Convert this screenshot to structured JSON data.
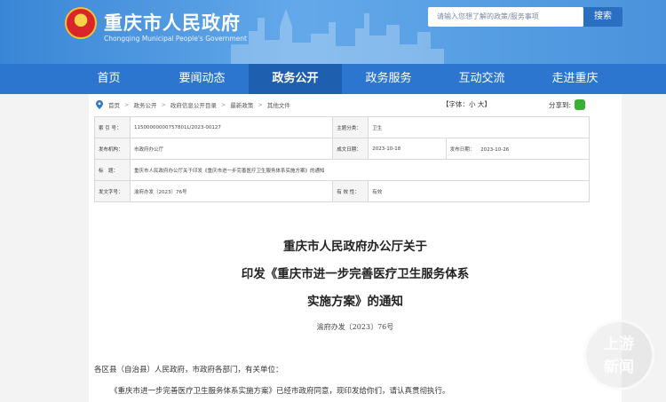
{
  "header": {
    "site_title": "重庆市人民政府",
    "site_subtitle": "Chongqing Municipal People's Government",
    "search_placeholder": "请输入您想了解的政策/服务事项",
    "search_button": "搜索"
  },
  "nav": {
    "items": [
      "首页",
      "要闻动态",
      "政务公开",
      "政务服务",
      "互动交流",
      "走进重庆"
    ],
    "active_index": 2
  },
  "breadcrumb": [
    "首页",
    "政务公开",
    "政府信息公开目录",
    "最新政策",
    "其他文件"
  ],
  "toolbar": {
    "font_size": "【字体：小 大】",
    "share": "分享到:"
  },
  "meta": {
    "index_no_label": "索 引 号：",
    "index_no": "11500000000757801L/2023-00127",
    "category_label": "主题分类：",
    "category": "卫生",
    "issuer_label": "发布机构：",
    "issuer": "市政府办公厅",
    "created_label": "成文日期：",
    "created": "2023-10-18",
    "published_label": "发布日期：",
    "published": "2023-10-26",
    "subject_label": "标　题：",
    "subject": "重庆市人民政府办公厅关于印发《重庆市进一步完善医疗卫生服务体系实施方案》的通知",
    "doc_no_label": "发文字号：",
    "doc_no": "渝府办发〔2023〕76号",
    "validity_label": "有 效 性：",
    "validity": "有效"
  },
  "document": {
    "title_lines": [
      "重庆市人民政府办公厅关于",
      "印发《重庆市进一步完善医疗卫生服务体系",
      "实施方案》的通知"
    ],
    "number": "渝府办发〔2023〕76号",
    "salutation": "各区县（自治县）人民政府，市政府各部门，有关单位：",
    "body": "《重庆市进一步完善医疗卫生服务体系实施方案》已经市政府同意，现印发给你们，请认真贯彻执行。"
  },
  "watermark": {
    "line1": "上游",
    "line2": "新闻"
  },
  "colors": {
    "nav": "#2d76cf",
    "nav_active": "#1f5fb0",
    "header": "#4a93dc"
  }
}
